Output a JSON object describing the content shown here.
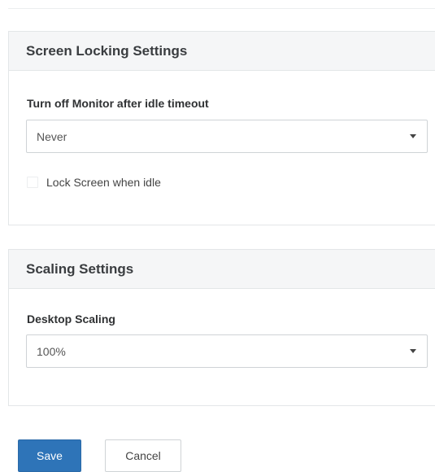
{
  "screen_locking": {
    "title": "Screen Locking Settings",
    "monitor_label": "Turn off Monitor after idle timeout",
    "monitor_value": "Never",
    "lock_label": "Lock Screen when idle",
    "lock_checked": false
  },
  "scaling": {
    "title": "Scaling Settings",
    "desktop_label": "Desktop Scaling",
    "desktop_value": "100%"
  },
  "actions": {
    "save": "Save",
    "cancel": "Cancel"
  },
  "colors": {
    "primary": "#2e74b8",
    "panel_header_bg": "#f5f6f7",
    "border": "#e3e6e8"
  },
  "icons": {
    "dropdown": "caret-down-icon",
    "checkbox": "checkbox-unchecked-icon"
  }
}
